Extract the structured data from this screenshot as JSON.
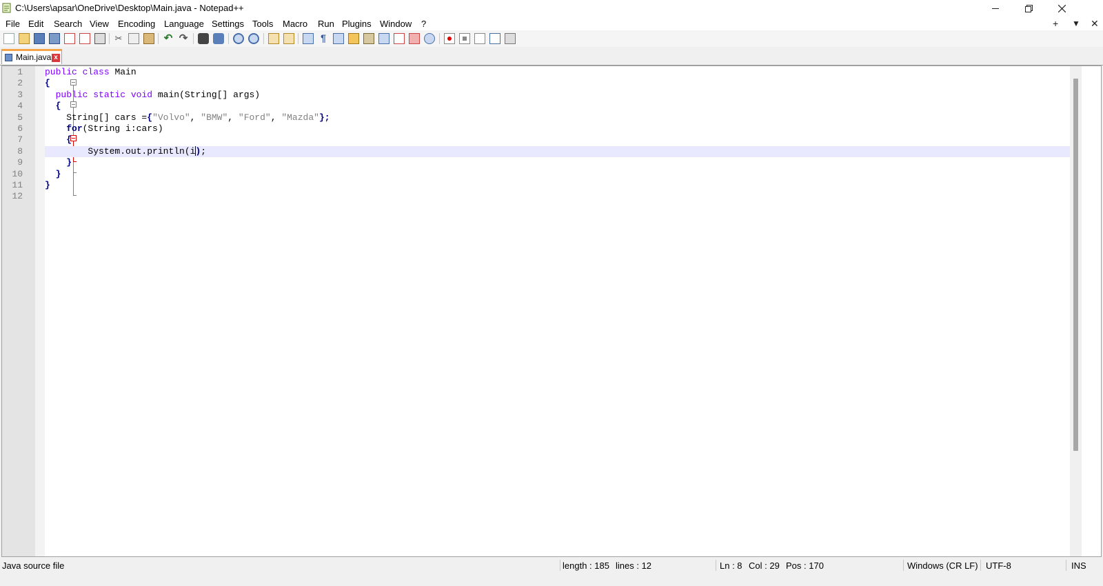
{
  "window": {
    "title": "C:\\Users\\apsar\\OneDrive\\Desktop\\Main.java - Notepad++",
    "minimize_icon": "minimize-icon",
    "maximize_icon": "restore-icon",
    "close_icon": "close-icon"
  },
  "menubar": {
    "items": [
      "File",
      "Edit",
      "Search",
      "View",
      "Encoding",
      "Language",
      "Settings",
      "Tools",
      "Macro",
      "Run",
      "Plugins",
      "Window",
      "?"
    ],
    "right_icons": [
      "new-tab-plus-icon",
      "list-tabs-icon",
      "close-tab-icon"
    ],
    "right_glyphs": [
      "+",
      "▼",
      "✕"
    ]
  },
  "toolbar": {
    "icons": [
      "new-icon",
      "open-icon",
      "save-icon",
      "save-all-icon",
      "close-icon",
      "close-all-icon",
      "print-icon",
      "cut-icon",
      "copy-icon",
      "paste-icon",
      "undo-icon",
      "redo-icon",
      "find-icon",
      "replace-icon",
      "zoom-in-icon",
      "zoom-out-icon",
      "sync-vertical-icon",
      "sync-horizontal-icon",
      "word-wrap-icon",
      "show-all-chars-icon",
      "indent-guide-icon",
      "user-lang-icon",
      "doc-map-icon",
      "function-list-icon",
      "folder-workspace-icon",
      "monitor-icon",
      "eye-icon",
      "record-macro-icon",
      "stop-macro-icon",
      "play-macro-icon",
      "run-macro-multiple-icon",
      "save-macro-icon"
    ]
  },
  "tab": {
    "label": "Main.java",
    "icon": "saved-file-icon",
    "close_glyph": "x"
  },
  "editor": {
    "line_numbers": [
      "1",
      "2",
      "3",
      "4",
      "5",
      "6",
      "7",
      "8",
      "9",
      "10",
      "11",
      "12"
    ],
    "current_line": 8,
    "lines": [
      {
        "indent": "",
        "parts": [
          {
            "t": "public",
            "c": "kw"
          },
          {
            "t": " "
          },
          {
            "t": "class",
            "c": "kw"
          },
          {
            "t": " Main"
          }
        ]
      },
      {
        "indent": "",
        "parts": [
          {
            "t": "{",
            "c": "op"
          }
        ]
      },
      {
        "indent": "  ",
        "parts": [
          {
            "t": "public",
            "c": "kw"
          },
          {
            "t": " "
          },
          {
            "t": "static",
            "c": "kw"
          },
          {
            "t": " "
          },
          {
            "t": "void",
            "c": "kw"
          },
          {
            "t": " main(String[] args)"
          }
        ]
      },
      {
        "indent": "  ",
        "parts": [
          {
            "t": "{",
            "c": "op"
          }
        ]
      },
      {
        "indent": "    ",
        "parts": [
          {
            "t": "String[] cars ="
          },
          {
            "t": "{",
            "c": "op"
          },
          {
            "t": "\"Volvo\"",
            "c": "str"
          },
          {
            "t": ", "
          },
          {
            "t": "\"BMW\"",
            "c": "str"
          },
          {
            "t": ", "
          },
          {
            "t": "\"Ford\"",
            "c": "str"
          },
          {
            "t": ", "
          },
          {
            "t": "\"Mazda\"",
            "c": "str"
          },
          {
            "t": "};",
            "c": "op"
          }
        ]
      },
      {
        "indent": "    ",
        "parts": [
          {
            "t": "for",
            "c": "kwb"
          },
          {
            "t": "(String i:cars)"
          }
        ]
      },
      {
        "indent": "    ",
        "parts": [
          {
            "t": "{",
            "c": "op"
          }
        ]
      },
      {
        "indent": "        ",
        "parts": [
          {
            "t": "System.out.println(i"
          },
          {
            "t": ")",
            "c": "op"
          },
          {
            "t": ";"
          }
        ]
      },
      {
        "indent": "    ",
        "parts": [
          {
            "t": "}",
            "c": "op"
          }
        ]
      },
      {
        "indent": "  ",
        "parts": [
          {
            "t": "}",
            "c": "op"
          }
        ]
      },
      {
        "indent": "",
        "parts": [
          {
            "t": "}",
            "c": "op"
          }
        ]
      },
      {
        "indent": "",
        "parts": []
      }
    ]
  },
  "statusbar": {
    "file_type": "Java source file",
    "length": "length : 185",
    "lines": "lines : 12",
    "ln": "Ln : 8",
    "col": "Col : 29",
    "pos": "Pos : 170",
    "eol": "Windows (CR LF)",
    "encoding": "UTF-8",
    "mode": "INS"
  }
}
